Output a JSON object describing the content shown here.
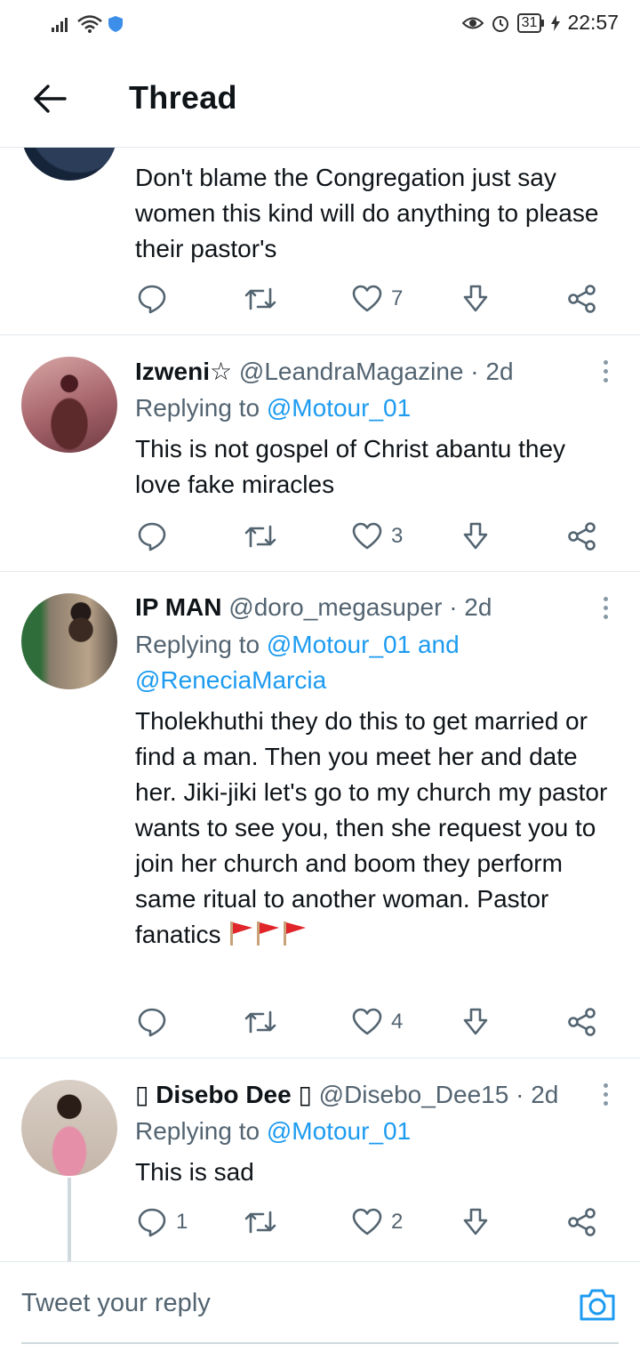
{
  "status_bar": {
    "time": "22:57",
    "battery": "31",
    "icons": [
      "signal-icon",
      "wifi-icon",
      "shield-icon",
      "eye-icon",
      "alarm-icon",
      "charging-icon"
    ]
  },
  "header": {
    "title": "Thread",
    "back_icon": "arrow-left-icon"
  },
  "tweets": [
    {
      "text": "Don't blame the Congregation just say women this kind will do anything to please their pastor's",
      "replies": "",
      "retweets": "",
      "likes": "7"
    },
    {
      "name": "Izweni☆",
      "handle": "@LeandraMagazine",
      "time": "· 2d",
      "replying_prefix": "Replying to ",
      "replying_to": "@Motour_01",
      "text": "This is not gospel of Christ abantu they love fake miracles",
      "replies": "",
      "retweets": "",
      "likes": "3"
    },
    {
      "name": "IP MAN",
      "handle": "@doro_megasuper",
      "time": "· 2d",
      "replying_prefix": "Replying to ",
      "replying_to": "@Motour_01 and",
      "replying_to_2": "@ReneciaMarcia",
      "text": "Tholekhuthi they do this to get married or find a man. Then you meet her and date her. Jiki-jiki let's go to my church my pastor wants to see you, then she request you to join her church and boom they perform same ritual to another woman. Pastor fanatics",
      "emoji": [
        "red-flag-icon",
        "red-flag-icon",
        "red-flag-icon"
      ],
      "replies": "",
      "retweets": "",
      "likes": "4"
    },
    {
      "name": "▯ Disebo Dee ▯",
      "handle": "@Disebo_Dee15",
      "time": "· 2d",
      "replying_prefix": "Replying to ",
      "replying_to": "@Motour_01",
      "text": "This is sad",
      "replies": "1",
      "retweets": "",
      "likes": "2"
    }
  ],
  "reply_bar": {
    "placeholder": "Tweet your reply",
    "camera_icon": "camera-icon"
  },
  "colors": {
    "accent": "#1d9bf0",
    "muted": "#536471",
    "text": "#0f1419",
    "divider": "#e1e8ed",
    "flag": "#e0262b"
  }
}
